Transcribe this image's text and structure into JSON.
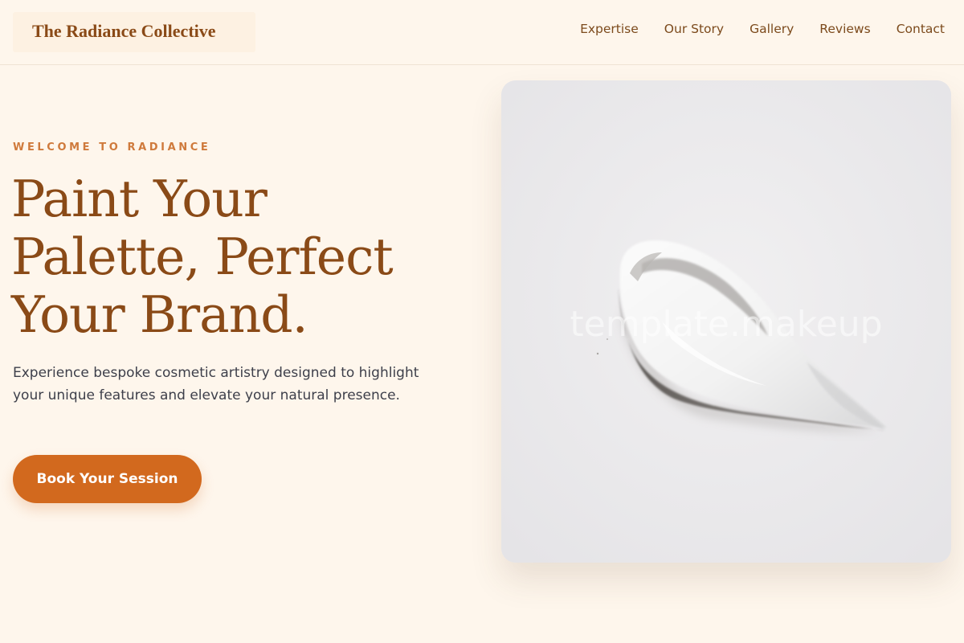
{
  "header": {
    "brand": "The Radiance Collective",
    "nav": [
      "Expertise",
      "Our Story",
      "Gallery",
      "Reviews",
      "Contact"
    ]
  },
  "hero": {
    "eyebrow": "WELCOME TO RADIANCE",
    "headline": [
      "Paint Your",
      "Palette, Perfect",
      "Your Brand."
    ],
    "subtext": "Experience bespoke cosmetic artistry designed to highlight your unique features and elevate your natural presence.",
    "cta_label": "Book Your Session",
    "image": {
      "subject": "white cream swatch on light grey background",
      "watermark": "template.makeup"
    }
  },
  "colors": {
    "background": "#fef6ec",
    "brand_brown": "#8a4a17",
    "accent_orange": "#d2691e",
    "eyebrow_orange": "#cf7a3c",
    "body_text": "#3d3f4a"
  }
}
